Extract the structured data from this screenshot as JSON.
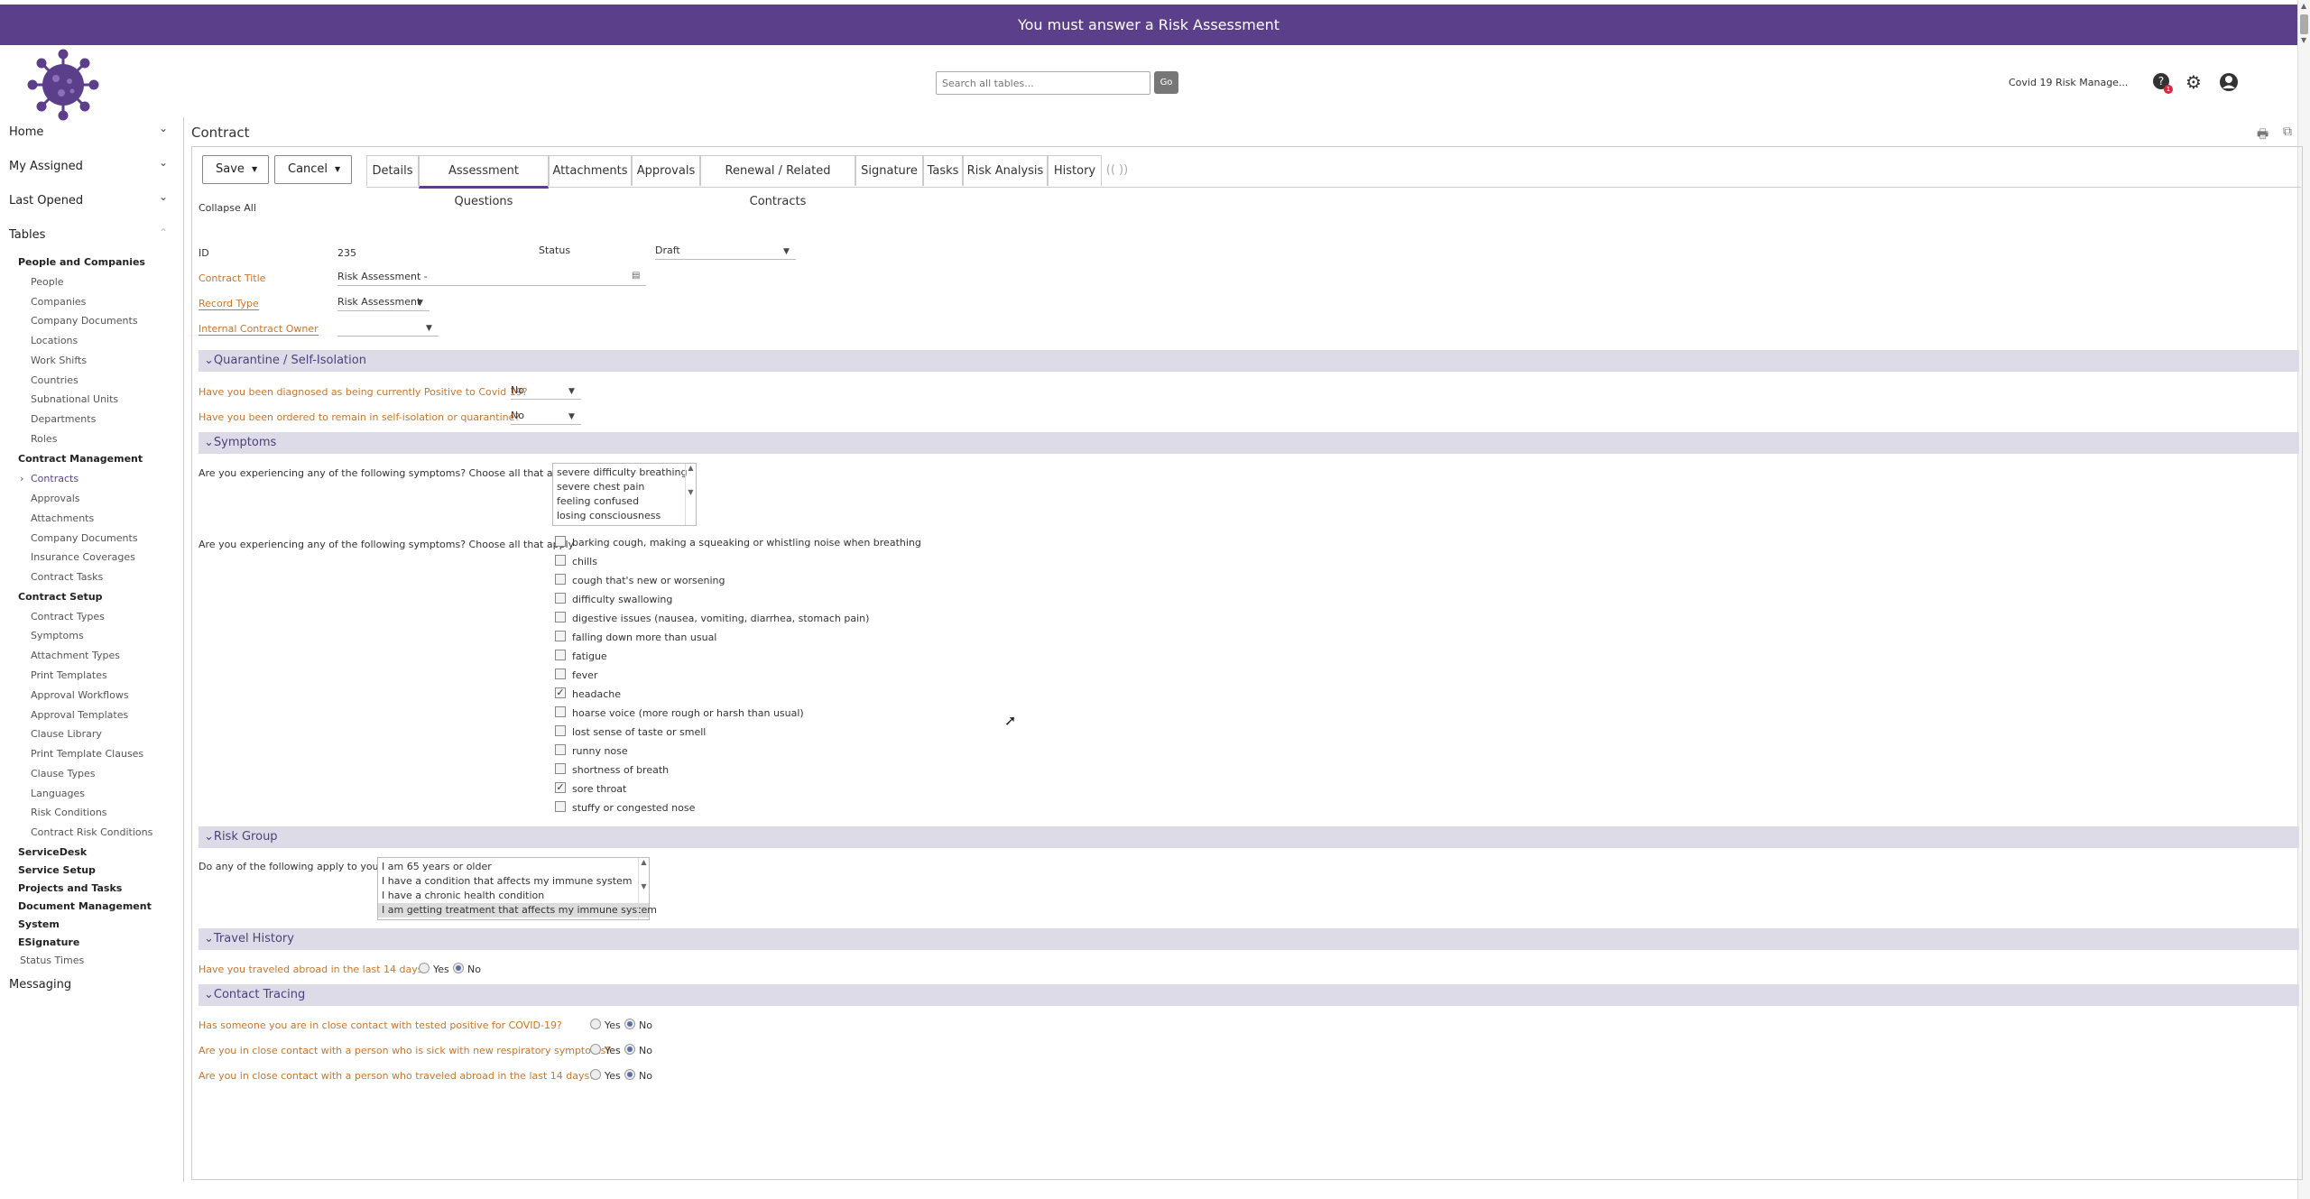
{
  "banner": {
    "text": "You must answer a Risk Assessment"
  },
  "header": {
    "search_placeholder": "Search all tables...",
    "go_label": "Go",
    "app_name": "Covid 19 Risk Manage...",
    "notification_count": "1"
  },
  "sidebar": {
    "sections": [
      "Home",
      "My Assigned",
      "Last Opened",
      "Tables"
    ],
    "people_and_companies": {
      "label": "People and Companies",
      "items": [
        "People",
        "Companies",
        "Company Documents",
        "Locations",
        "Work Shifts",
        "Countries",
        "Subnational Units",
        "Departments",
        "Roles"
      ]
    },
    "contract_management": {
      "label": "Contract Management",
      "items": [
        "Contracts",
        "Approvals",
        "Attachments",
        "Company Documents",
        "Insurance Coverages",
        "Contract Tasks"
      ]
    },
    "contract_setup": {
      "label": "Contract Setup",
      "items": [
        "Contract Types",
        "Symptoms",
        "Attachment Types",
        "Print Templates",
        "Approval Workflows",
        "Approval Templates",
        "Clause Library",
        "Print Template Clauses",
        "Clause Types",
        "Languages",
        "Risk Conditions",
        "Contract Risk Conditions"
      ]
    },
    "other_groups": [
      "ServiceDesk",
      "Service Setup",
      "Projects and Tasks",
      "Document Management",
      "System",
      "ESignature"
    ],
    "status_times": "Status Times",
    "messaging": "Messaging"
  },
  "main": {
    "title": "Contract",
    "save_label": "Save",
    "cancel_label": "Cancel",
    "tabs": [
      "Details",
      "Assessment Questions",
      "Attachments",
      "Approvals",
      "Renewal / Related Contracts",
      "Signature",
      "Tasks",
      "Risk Analysis",
      "History",
      "(( ))"
    ],
    "collapse_all": "Collapse All",
    "fields": {
      "id_label": "ID",
      "id_value": "235",
      "status_label": "Status",
      "status_value": "Draft",
      "contract_title_label": "Contract Title",
      "contract_title_value": "Risk Assessment -",
      "record_type_label": "Record Type",
      "record_type_value": "Risk Assessment",
      "owner_label": "Internal Contract Owner",
      "owner_value": ""
    },
    "quarantine": {
      "title": "Quarantine / Self-Isolation",
      "q1": "Have you been diagnosed as being currently Positive to Covid 19?",
      "a1": "No",
      "q2": "Have you been ordered to remain in self-isolation or quarantine?",
      "a2": "No"
    },
    "symptoms": {
      "title": "Symptoms",
      "q1": "Are you experiencing any of the following symptoms? Choose all that apply",
      "list1": [
        "severe difficulty breathing",
        "severe chest pain",
        "feeling confused",
        "losing consciousness"
      ],
      "q2": "Are you experiencing any of the following symptoms? Choose all that apply",
      "checks": [
        {
          "label": "barking cough, making a squeaking or whistling noise when breathing",
          "checked": false
        },
        {
          "label": "chills",
          "checked": false
        },
        {
          "label": "cough that's new or worsening",
          "checked": false
        },
        {
          "label": "difficulty swallowing",
          "checked": false
        },
        {
          "label": "digestive issues (nausea, vomiting, diarrhea, stomach pain)",
          "checked": false
        },
        {
          "label": "falling down more than usual",
          "checked": false
        },
        {
          "label": "fatigue",
          "checked": false
        },
        {
          "label": "fever",
          "checked": false
        },
        {
          "label": "headache",
          "checked": true
        },
        {
          "label": "hoarse voice (more rough or harsh than usual)",
          "checked": false
        },
        {
          "label": "lost sense of taste or smell",
          "checked": false
        },
        {
          "label": "runny nose",
          "checked": false
        },
        {
          "label": "shortness of breath",
          "checked": false
        },
        {
          "label": "sore throat",
          "checked": true
        },
        {
          "label": "stuffy or congested nose",
          "checked": false
        }
      ]
    },
    "risk_group": {
      "title": "Risk Group",
      "q1": "Do any of the following apply to you?",
      "list": [
        "I am 65 years or older",
        "I have a condition that affects my immune system",
        "I have a chronic health condition",
        "I am getting treatment that affects my immune system"
      ]
    },
    "travel": {
      "title": "Travel History",
      "q1": "Have you traveled abroad in the last 14 days?",
      "yes": "Yes",
      "no": "No"
    },
    "contact": {
      "title": "Contact Tracing",
      "q1": "Has someone you are in close contact with tested positive for COVID-19?",
      "q2": "Are you in close contact with a person who is sick with new respiratory symptoms?",
      "q3": "Are you in close contact with a person who traveled abroad in the last 14 days?",
      "yes": "Yes",
      "no": "No"
    }
  }
}
